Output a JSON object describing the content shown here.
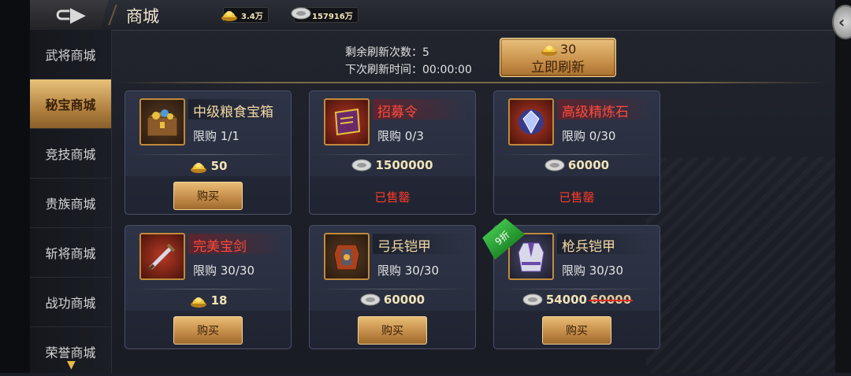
{
  "header": {
    "back_icon": "back-arrow-icon",
    "title": "商城",
    "gold_amount": "3.4万",
    "silver_amount": "157916万"
  },
  "sidebar": {
    "items": [
      {
        "label": "武将商城",
        "active": false
      },
      {
        "label": "秘宝商城",
        "active": true
      },
      {
        "label": "竞技商城",
        "active": false
      },
      {
        "label": "贵族商城",
        "active": false
      },
      {
        "label": "斩将商城",
        "active": false
      },
      {
        "label": "战功商城",
        "active": false
      },
      {
        "label": "荣誉商城",
        "active": false
      }
    ]
  },
  "refresh": {
    "remaining_label": "剩余刷新次数：5",
    "next_time_label": "下次刷新时间：00:00:00",
    "cost": "30",
    "button_label": "立即刷新"
  },
  "cards": [
    {
      "name": "中级粮食宝箱",
      "name_red": false,
      "icon": "treasure-chest-icon",
      "limit": "限购 1/1",
      "currency": "gold",
      "price": "50",
      "old_price": "",
      "status": "buy",
      "button_label": "购买"
    },
    {
      "name": "招募令",
      "name_red": true,
      "icon": "recruit-token-icon",
      "limit": "限购 0/3",
      "currency": "silver",
      "price": "1500000",
      "old_price": "",
      "status": "sold",
      "sold_label": "已售罄"
    },
    {
      "name": "高级精炼石",
      "name_red": true,
      "icon": "refine-stone-icon",
      "limit": "限购 0/30",
      "currency": "silver",
      "price": "60000",
      "old_price": "",
      "status": "sold",
      "sold_label": "已售罄"
    },
    {
      "name": "完美宝剑",
      "name_red": true,
      "icon": "sword-icon",
      "limit": "限购 30/30",
      "currency": "gold",
      "price": "18",
      "old_price": "",
      "status": "buy",
      "button_label": "购买"
    },
    {
      "name": "弓兵铠甲",
      "name_red": false,
      "icon": "archer-armor-icon",
      "limit": "限购 30/30",
      "currency": "silver",
      "price": "60000",
      "old_price": "",
      "status": "buy",
      "button_label": "购买"
    },
    {
      "name": "枪兵铠甲",
      "name_red": false,
      "icon": "spear-armor-icon",
      "limit": "限购 30/30",
      "currency": "silver",
      "price": "54000",
      "old_price": "60000",
      "status": "buy",
      "button_label": "购买"
    }
  ],
  "discount_tag": "9折",
  "colors": {
    "gold_button": "#c9914a",
    "red_name": "#ff4a3a",
    "sold_out": "#ff3a2a",
    "discount_green": "#2fa83a"
  }
}
